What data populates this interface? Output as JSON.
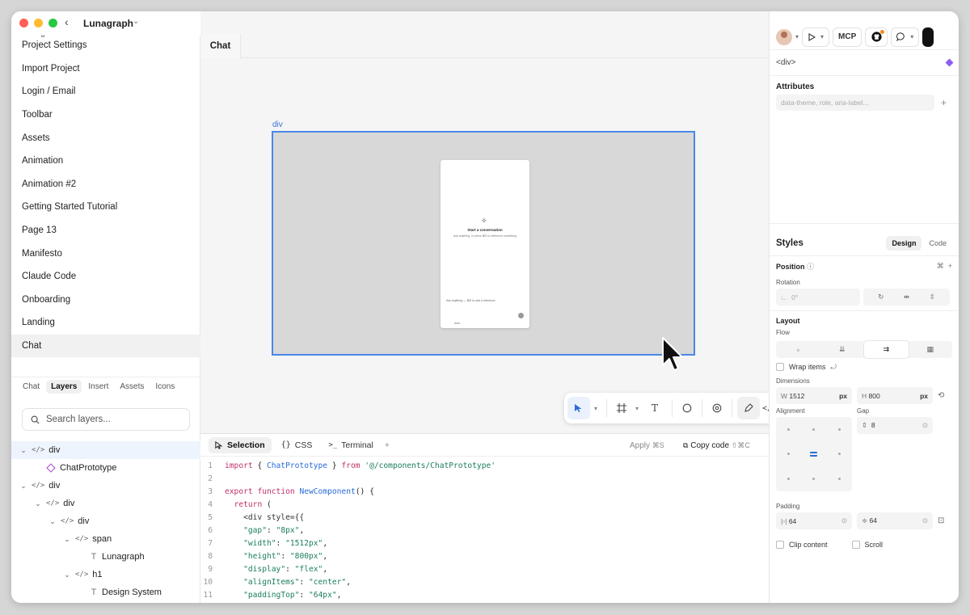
{
  "window": {
    "title": "Lunagraph"
  },
  "sidebar": {
    "cut_item": "Design <> Code",
    "pages": [
      "Project Settings",
      "Import Project",
      "Login / Email",
      "Toolbar",
      "Assets",
      "Animation",
      "Animation #2",
      "Getting Started Tutorial",
      "Page 13",
      "Manifesto",
      "Claude Code",
      "Onboarding",
      "Landing",
      "Chat"
    ],
    "selected_page": "Chat",
    "tabs": [
      "Chat",
      "Layers",
      "Insert",
      "Assets",
      "Icons"
    ],
    "active_tab": "Layers",
    "search_placeholder": "Search layers...",
    "layers": [
      {
        "label": "div",
        "kind": "tag",
        "depth": 0,
        "expanded": true,
        "selected": true
      },
      {
        "label": "ChatPrototype",
        "kind": "component",
        "depth": 1
      },
      {
        "label": "div",
        "kind": "tag",
        "depth": 0,
        "expanded": true
      },
      {
        "label": "div",
        "kind": "tag",
        "depth": 1,
        "expanded": true
      },
      {
        "label": "div",
        "kind": "tag",
        "depth": 2,
        "expanded": true
      },
      {
        "label": "span",
        "kind": "tag",
        "depth": 3,
        "expanded": true
      },
      {
        "label": "Lunagraph",
        "kind": "text",
        "depth": 4
      },
      {
        "label": "h1",
        "kind": "tag",
        "depth": 3,
        "expanded": true
      },
      {
        "label": "Design System",
        "kind": "text",
        "depth": 4
      }
    ]
  },
  "canvas": {
    "tab": "Chat",
    "frame_label": "div",
    "prototype": {
      "title": "Start a conversation",
      "subtitle": "Ask anything, or press ⌘K to reference something",
      "input_placeholder": "Ask anything — ⌘K to add a reference",
      "model": "Auto"
    }
  },
  "toolbar": {
    "tools": [
      "select",
      "frame",
      "text",
      "comment",
      "component",
      "pen",
      "code"
    ]
  },
  "codepanel": {
    "tabs": [
      "Selection",
      "CSS",
      "Terminal"
    ],
    "active_tab": "Selection",
    "apply_label": "Apply",
    "apply_shortcut": "⌘S",
    "copy_label": "Copy code",
    "copy_shortcut": "⇧⌘C",
    "lines": [
      [
        {
          "t": "import",
          "c": "kw"
        },
        {
          "t": " { ",
          "c": "tx"
        },
        {
          "t": "ChatPrototype",
          "c": "fn"
        },
        {
          "t": " } ",
          "c": "tx"
        },
        {
          "t": "from",
          "c": "kw"
        },
        {
          "t": " '@/components/ChatPrototype'",
          "c": "str"
        }
      ],
      [],
      [
        {
          "t": "export",
          "c": "kw"
        },
        {
          "t": " ",
          "c": "tx"
        },
        {
          "t": "function",
          "c": "kw"
        },
        {
          "t": " ",
          "c": "tx"
        },
        {
          "t": "NewComponent",
          "c": "fn"
        },
        {
          "t": "() {",
          "c": "tx"
        }
      ],
      [
        {
          "t": "  ",
          "c": "tx"
        },
        {
          "t": "return",
          "c": "kw"
        },
        {
          "t": " (",
          "c": "tx"
        }
      ],
      [
        {
          "t": "    <div style={{",
          "c": "ag"
        }
      ],
      [
        {
          "t": "    ",
          "c": "tx"
        },
        {
          "t": "\"gap\"",
          "c": "str"
        },
        {
          "t": ": ",
          "c": "tx"
        },
        {
          "t": "\"8px\"",
          "c": "str"
        },
        {
          "t": ",",
          "c": "tx"
        }
      ],
      [
        {
          "t": "    ",
          "c": "tx"
        },
        {
          "t": "\"width\"",
          "c": "str"
        },
        {
          "t": ": ",
          "c": "tx"
        },
        {
          "t": "\"1512px\"",
          "c": "str"
        },
        {
          "t": ",",
          "c": "tx"
        }
      ],
      [
        {
          "t": "    ",
          "c": "tx"
        },
        {
          "t": "\"height\"",
          "c": "str"
        },
        {
          "t": ": ",
          "c": "tx"
        },
        {
          "t": "\"800px\"",
          "c": "str"
        },
        {
          "t": ",",
          "c": "tx"
        }
      ],
      [
        {
          "t": "    ",
          "c": "tx"
        },
        {
          "t": "\"display\"",
          "c": "str"
        },
        {
          "t": ": ",
          "c": "tx"
        },
        {
          "t": "\"flex\"",
          "c": "str"
        },
        {
          "t": ",",
          "c": "tx"
        }
      ],
      [
        {
          "t": "    ",
          "c": "tx"
        },
        {
          "t": "\"alignItems\"",
          "c": "str"
        },
        {
          "t": ": ",
          "c": "tx"
        },
        {
          "t": "\"center\"",
          "c": "str"
        },
        {
          "t": ",",
          "c": "tx"
        }
      ],
      [
        {
          "t": "    ",
          "c": "tx"
        },
        {
          "t": "\"paddingTop\"",
          "c": "str"
        },
        {
          "t": ": ",
          "c": "tx"
        },
        {
          "t": "\"64px\"",
          "c": "str"
        },
        {
          "t": ",",
          "c": "tx"
        }
      ]
    ]
  },
  "rightpanel": {
    "mcp_label": "MCP",
    "element_tag": "<div>",
    "attributes_title": "Attributes",
    "attributes_placeholder": "data-theme, role, aria-label...",
    "styles_title": "Styles",
    "styles_tabs": [
      "Design",
      "Code"
    ],
    "styles_active": "Design",
    "position_label": "Position",
    "rotation_label": "Rotation",
    "rotation_value": "0°",
    "layout_label": "Layout",
    "flow_label": "Flow",
    "wrap_label": "Wrap items",
    "dimensions_label": "Dimensions",
    "width_prefix": "W",
    "width_value": "1512",
    "height_prefix": "H",
    "height_value": "800",
    "unit": "px",
    "alignment_label": "Alignment",
    "gap_label": "Gap",
    "gap_value": "8",
    "padding_label": "Padding",
    "padding_h": "64",
    "padding_v": "64",
    "clip_label": "Clip content",
    "scroll_label": "Scroll"
  },
  "colors": {
    "accent": "#4a86e8",
    "component": "#a744c8",
    "notif": "#f08a24"
  }
}
